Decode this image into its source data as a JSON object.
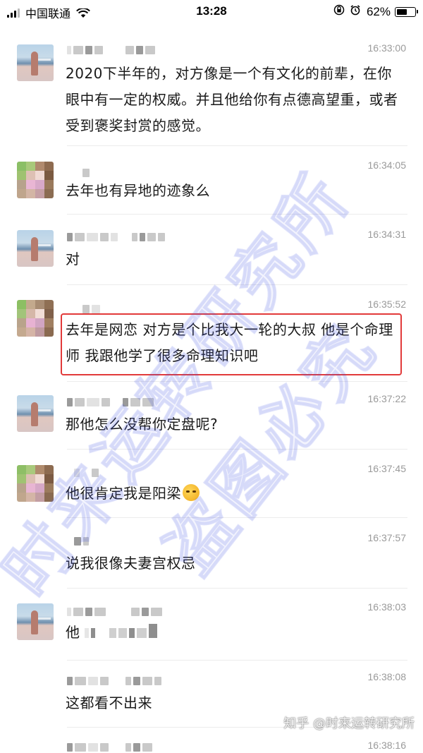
{
  "status_bar": {
    "carrier": "中国联通",
    "time": "13:28",
    "battery_percent": "62%",
    "battery_level": 0.62
  },
  "messages": [
    {
      "time": "16:33:00",
      "text": "2020下半年的，对方像是一个有文化的前辈，在你眼中有一定的权威。并且他给你有点德高望重，或者受到褒奖封赏的感觉。"
    },
    {
      "time": "16:34:05",
      "text": "去年也有异地的迹象么"
    },
    {
      "time": "16:34:31",
      "text": "对"
    },
    {
      "time": "16:35:52",
      "text": "去年是网恋 对方是个比我大一轮的大叔 他是个命理师 我跟他学了很多命理知识吧"
    },
    {
      "time": "16:37:22",
      "text": "那他怎么没帮你定盘呢?"
    },
    {
      "time": "16:37:45",
      "text": "他很肯定我是阳梁"
    },
    {
      "time": "16:37:57",
      "text": "说我很像夫妻宫权忌"
    },
    {
      "time": "16:38:03",
      "text": "他"
    },
    {
      "time": "16:38:08",
      "text": "这都看不出来"
    },
    {
      "time": "16:38:16",
      "text": ""
    }
  ],
  "watermark": {
    "text_a": "时来运转研究所",
    "text_b": "盗图必究",
    "footer": "知乎 @时来运转研究所"
  }
}
